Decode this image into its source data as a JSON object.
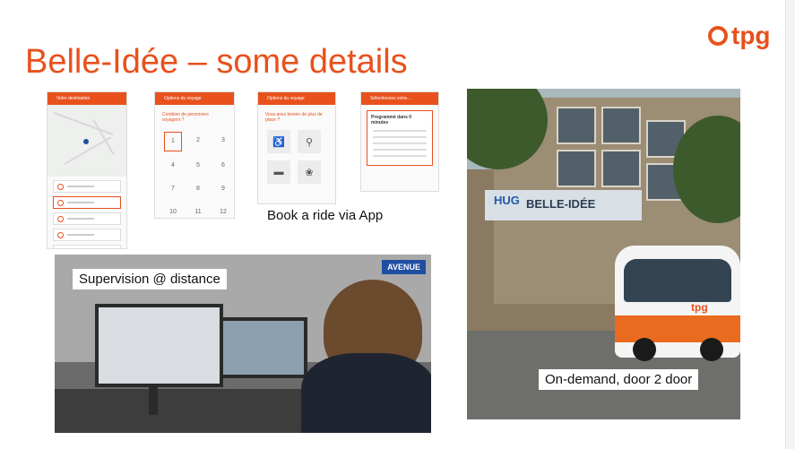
{
  "slide": {
    "title": "Belle-Idée – some details",
    "logo_text": "tpg",
    "accent_color": "#e8511c"
  },
  "app": {
    "caption": "Book a ride via App",
    "screen1": {
      "header": "Votre destination"
    },
    "screen2": {
      "header": "Options du voyage",
      "question": "Combien de personnes voyagent ?",
      "numbers": [
        "1",
        "2",
        "3",
        "4",
        "5",
        "6",
        "7",
        "8",
        "9",
        "10",
        "11",
        "12"
      ]
    },
    "screen3": {
      "header": "Options du voyage",
      "question": "Vous avez besoin de plus de place ?"
    },
    "screen4": {
      "header": "Sélectionnez votre...",
      "schedule_title": "Programmé dans 0 minutes"
    }
  },
  "supervision": {
    "caption": "Supervision @ distance",
    "badge": "AVENUE"
  },
  "building": {
    "caption": "On-demand, door 2 door",
    "sign": "BELLE-IDÉE",
    "sign_logo": "HUG",
    "bus_logo": "tpg"
  }
}
